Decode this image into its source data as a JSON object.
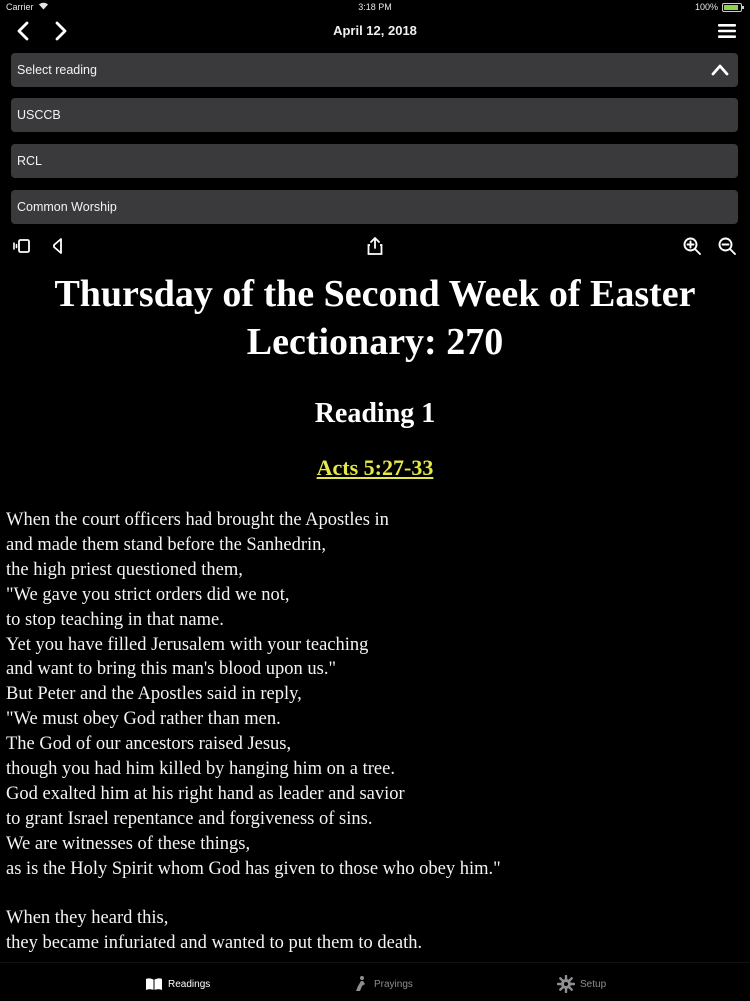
{
  "status_bar": {
    "carrier": "Carrier",
    "time": "3:18 PM",
    "battery": "100%"
  },
  "nav": {
    "date": "April 12, 2018"
  },
  "reading_selector": {
    "label": "Select reading",
    "options": [
      "USCCB",
      "RCL",
      "Common Worship"
    ]
  },
  "page": {
    "title_line1": "Thursday of the Second Week of Easter",
    "title_line2": "Lectionary: 270",
    "reading_heading": "Reading 1",
    "citation": "Acts 5:27-33",
    "passage_lines": [
      "When the court officers had brought the Apostles in",
      "and made them stand before the Sanhedrin,",
      "the high priest questioned them,",
      "\"We gave you strict orders did we not,",
      "to stop teaching in that name.",
      "Yet you have filled Jerusalem with your teaching",
      "and want to bring this man's blood upon us.\"",
      "But Peter and the Apostles said in reply,",
      "\"We must obey God rather than men.",
      "The God of our ancestors raised Jesus,",
      "though you had him killed by hanging him on a tree.",
      "God exalted him at his right hand as leader and savior",
      "to grant Israel repentance and forgiveness of sins.",
      "We are witnesses of these things,",
      "as is the Holy Spirit whom God has given to those who obey him.\"",
      "",
      "When they heard this,",
      "they became infuriated and wanted to put them to death."
    ]
  },
  "tabs": [
    {
      "label": "Readings",
      "icon": "book-icon",
      "active": true
    },
    {
      "label": "Prayings",
      "icon": "praying-icon",
      "active": false
    },
    {
      "label": "Setup",
      "icon": "gear-icon",
      "active": false
    }
  ],
  "colors": {
    "background": "#000000",
    "row": "#3a3a3c",
    "citation": "#e6e84a",
    "inactive_tab": "#8e8e93"
  }
}
